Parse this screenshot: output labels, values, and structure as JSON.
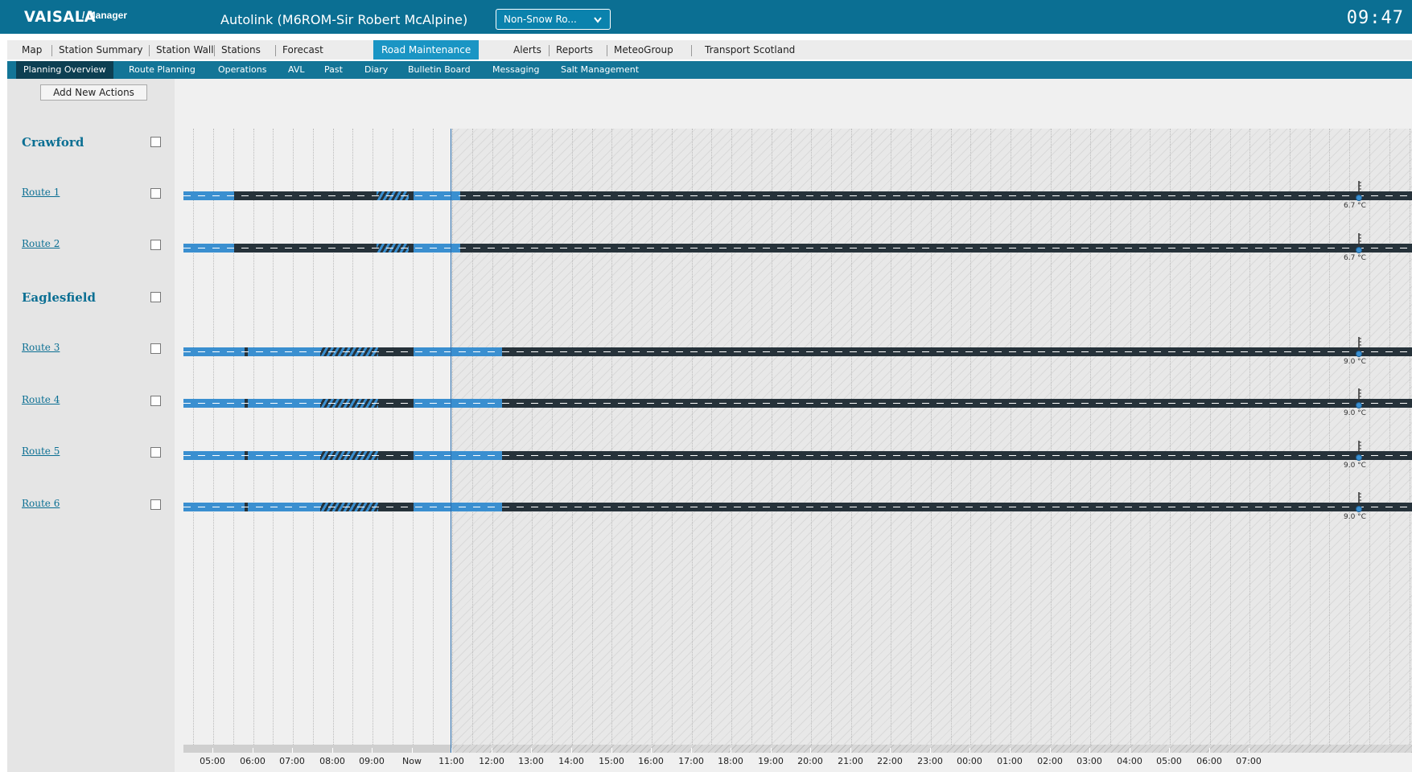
{
  "header": {
    "logo": "VAISALA",
    "logo_sub": "/ Manager",
    "title": "Autolink (M6ROM-Sir Robert McAlpine)",
    "filter": "Non-Snow Ro...",
    "clock": "09:47"
  },
  "nav": {
    "items": [
      "Map",
      "Station Summary",
      "Station Wall",
      "Stations",
      "Forecast",
      "Road Maintenance",
      "Alerts",
      "Reports",
      "MeteoGroup",
      "Transport Scotland"
    ],
    "active": "Road Maintenance"
  },
  "subnav": {
    "items": [
      "Planning Overview",
      "Route Planning",
      "Operations",
      "AVL",
      "Past",
      "Diary",
      "Bulletin Board",
      "Messaging",
      "Salt Management"
    ],
    "active": "Planning Overview"
  },
  "left_panel": {
    "add_button": "Add New Actions",
    "rows": [
      {
        "label": "Crawford",
        "type": "group"
      },
      {
        "label": "Route 1",
        "type": "route",
        "temp": "6.7 °C"
      },
      {
        "label": "Route 2",
        "type": "route",
        "temp": "6.7 °C"
      },
      {
        "label": "Eaglesfield",
        "type": "group"
      },
      {
        "label": "Route 3",
        "type": "route",
        "temp": "9.0 °C"
      },
      {
        "label": "Route 4",
        "type": "route",
        "temp": "9.0 °C"
      },
      {
        "label": "Route 5",
        "type": "route",
        "temp": "9.0 °C"
      },
      {
        "label": "Route 6",
        "type": "route",
        "temp": "9.0 °C"
      }
    ]
  },
  "axis": {
    "labels": [
      "05:00",
      "06:00",
      "07:00",
      "08:00",
      "09:00",
      "Now",
      "11:00",
      "12:00",
      "13:00",
      "14:00",
      "15:00",
      "16:00",
      "17:00",
      "18:00",
      "19:00",
      "20:00",
      "21:00",
      "22:00",
      "23:00",
      "00:00",
      "01:00",
      "02:00",
      "03:00",
      "04:00",
      "05:00",
      "06:00",
      "07:00"
    ]
  },
  "colors": {
    "brand": "#0b6f93",
    "active_tab": "#1a95c4",
    "treatment": "#3a8fd0",
    "road": "#26323a"
  }
}
